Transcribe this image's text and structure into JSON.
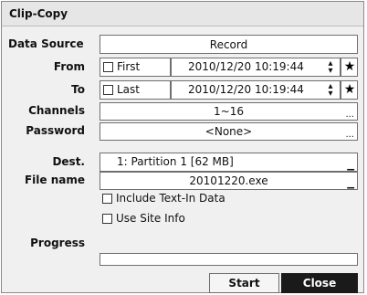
{
  "dialog": {
    "title": "Clip-Copy",
    "data_source": {
      "label": "Data Source",
      "value": "Record"
    },
    "from": {
      "label": "From",
      "checkbox_label": "First",
      "checked": false,
      "datetime": "2010/12/20  10:19:44"
    },
    "to": {
      "label": "To",
      "checkbox_label": "Last",
      "checked": false,
      "datetime": "2010/12/20  10:19:44"
    },
    "channels": {
      "label": "Channels",
      "value": "1~16",
      "more": "..."
    },
    "password": {
      "label": "Password",
      "value": "<None>",
      "more": "..."
    },
    "dest": {
      "label": "Dest.",
      "value": "1: Partition 1 [62 MB]"
    },
    "file_name": {
      "label": "File name",
      "value": "20101220.exe"
    },
    "include_text_in": {
      "label": "Include Text-In Data",
      "checked": false
    },
    "use_site_info": {
      "label": "Use Site Info",
      "checked": false
    },
    "progress": {
      "label": "Progress",
      "value": 0
    },
    "buttons": {
      "start": "Start",
      "close": "Close"
    },
    "icons": {
      "spin": "up-down-arrows-icon",
      "star": "star-icon"
    }
  }
}
